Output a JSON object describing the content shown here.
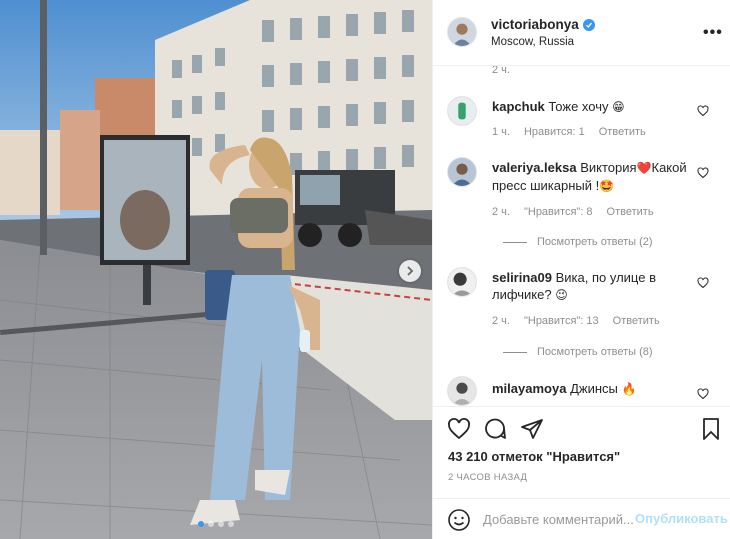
{
  "post": {
    "username": "victoriabonya",
    "location": "Moscow, Russia",
    "more_icon": "more-horizontal-icon",
    "photo_dots_count": 4,
    "photo_dot_active": 0
  },
  "comments": {
    "top_time": "2 ч.",
    "items": [
      {
        "username": "kapchuk",
        "text": "Тоже хочу",
        "emoji": "😁",
        "time": "1 ч.",
        "likes": "Нравится: 1",
        "reply": "Ответить"
      },
      {
        "username": "valeriya.leksa",
        "text": "Виктория",
        "emoji": "❤️",
        "text2": "Какой пресс шикарный !",
        "emoji2": "🤩",
        "time": "2 ч.",
        "likes": "\"Нравится\": 8",
        "reply": "Ответить",
        "view_replies": "Посмотреть ответы (2)"
      },
      {
        "username": "selirina09",
        "text": "Вика, по улице в лифчике?",
        "emoji": "😉",
        "time": "2 ч.",
        "likes": "\"Нравится\": 13",
        "reply": "Ответить",
        "view_replies": "Посмотреть ответы (8)"
      },
      {
        "username": "milayamoya",
        "text": "Джинсы",
        "emoji": "🔥"
      }
    ]
  },
  "actions": {
    "likes_text": "43 210 отметок \"Нравится\"",
    "time_ago": "2 ЧАСОВ НАЗАД"
  },
  "add_comment": {
    "placeholder": "Добавьте комментарий...",
    "publish_label": "Опубликовать"
  },
  "colors": {
    "accent": "#3897f0",
    "publish_disabled": "#b2dffc",
    "muted": "#8e8e8e",
    "text": "#262626"
  }
}
